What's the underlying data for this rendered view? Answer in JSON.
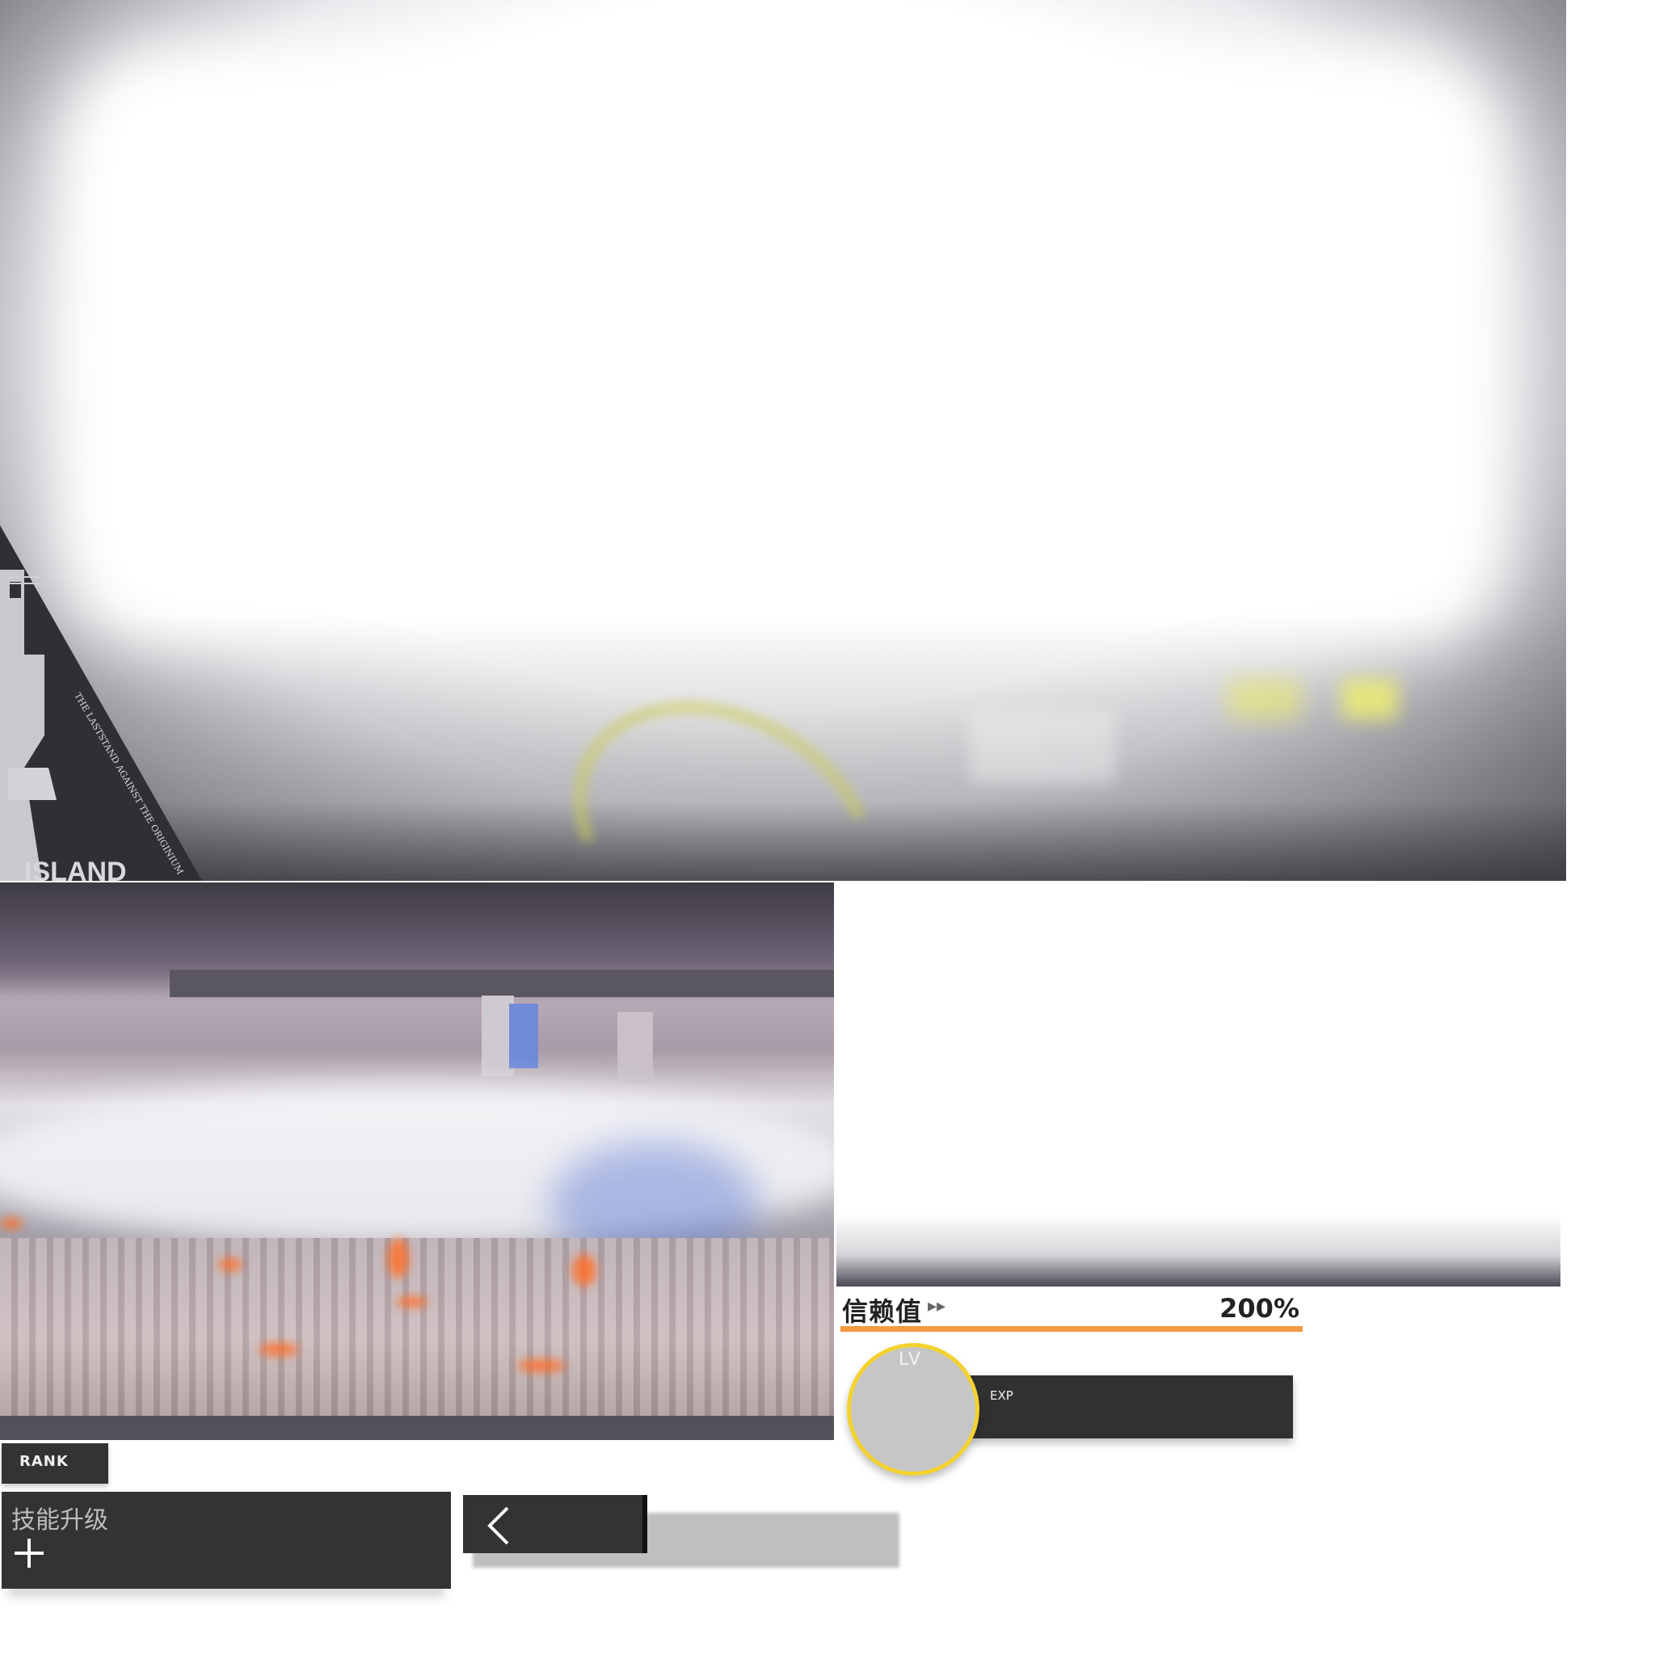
{
  "emblem": {
    "motto": "THE LASTSTAND AGAINST THE ORIGINIUM",
    "name": "ISLAND"
  },
  "trust": {
    "label": "信赖值",
    "value": "200%",
    "fill": 1.0,
    "bar_color": "#f49a42"
  },
  "level": {
    "lv_label": "LV",
    "exp_label": "EXP",
    "ring_color": "#f4d22e"
  },
  "rank": {
    "label": "RANK"
  },
  "skill": {
    "label": "技能升级",
    "icon": "plus-icon"
  },
  "back": {
    "icon": "chevron-left-icon"
  }
}
